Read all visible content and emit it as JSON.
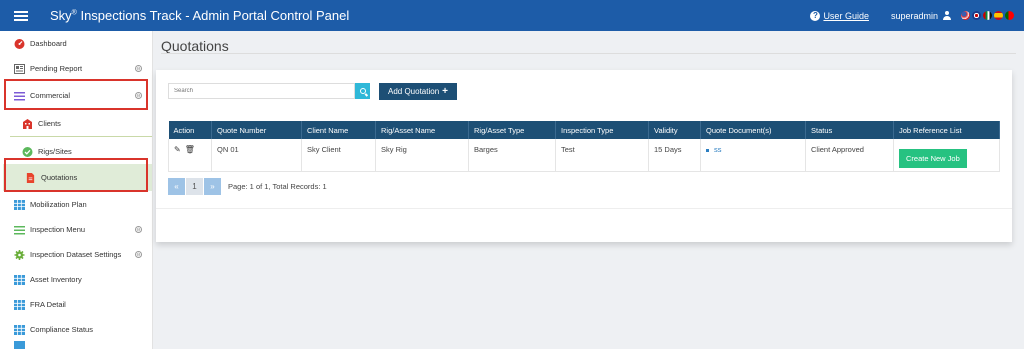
{
  "header": {
    "title_prefix": "Sky",
    "title_sup": "®",
    "title_rest": " Inspections Track - Admin Portal Control Panel",
    "help_icon": "?",
    "user_guide": "User Guide",
    "username": "superadmin",
    "bg_color": "#1d5ca8",
    "language_flags": [
      "us",
      "uk",
      "ae",
      "es",
      "pt"
    ]
  },
  "sidebar": {
    "items": [
      {
        "label": "Dashboard",
        "icon": "dashboard-icon"
      },
      {
        "label": "Pending Report",
        "icon": "report-icon",
        "chevron": "⊖"
      },
      {
        "label": "Commercial",
        "icon": "menu-lines-icon",
        "chevron": "⊖"
      },
      {
        "label": "Clients",
        "icon": "building-icon"
      },
      {
        "label": "Rigs/Sites",
        "icon": "check-circle-icon"
      },
      {
        "label": "Quotations",
        "icon": "document-icon"
      },
      {
        "label": "Mobilization Plan",
        "icon": "grid-icon"
      },
      {
        "label": "Inspection Menu",
        "icon": "menu-lines-icon",
        "chevron": "⊖"
      },
      {
        "label": "Inspection Dataset Settings",
        "icon": "gear-icon",
        "chevron": "⊖"
      },
      {
        "label": "Asset Inventory",
        "icon": "grid-icon"
      },
      {
        "label": "FRA Detail",
        "icon": "grid-icon"
      },
      {
        "label": "Compliance Status",
        "icon": "grid-icon"
      }
    ]
  },
  "page": {
    "title": "Quotations",
    "search_placeholder": "Search",
    "add_button": "Add Quotation",
    "add_icon": "+"
  },
  "table": {
    "headers": [
      "Action",
      "Quote Number",
      "Client Name",
      "Rig/Asset Name",
      "Rig/Asset Type",
      "Inspection Type",
      "Validity",
      "Quote Document(s)",
      "Status",
      "Job Reference List"
    ],
    "rows": [
      {
        "quote_number": "QN 01",
        "client_name": "Sky Client",
        "rig_name": "Sky Rig",
        "rig_type": "Barges",
        "inspection_type": "Test",
        "validity": "15 Days",
        "document": "ss",
        "status": "Client Approved",
        "job_button": "Create New Job"
      }
    ]
  },
  "pagination": {
    "prev": "«",
    "current": "1",
    "next": "»",
    "info": "Page: 1 of 1, Total Records: 1"
  },
  "colors": {
    "header_bar": "#1d5ca8",
    "table_header": "#1d4f75",
    "search_button": "#2fb8d8",
    "create_job": "#26c281",
    "highlight_box": "#d9342b",
    "active_item": "#e0ecd8"
  }
}
